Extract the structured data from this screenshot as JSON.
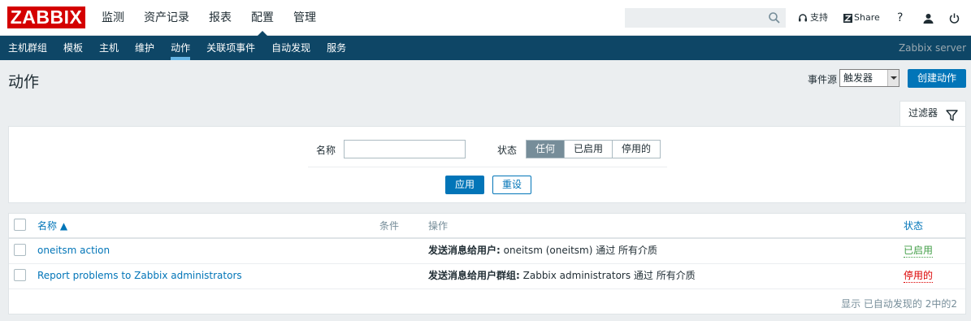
{
  "header": {
    "logo": "ZABBIX",
    "menu": [
      "监测",
      "资产记录",
      "报表",
      "配置",
      "管理"
    ],
    "active_menu": "配置",
    "search_placeholder": "",
    "support_label": "支持",
    "share_label": "Share",
    "help_label": "?"
  },
  "submenu": {
    "items": [
      "主机群组",
      "模板",
      "主机",
      "维护",
      "动作",
      "关联项事件",
      "自动发现",
      "服务"
    ],
    "active": "动作",
    "server_name": "Zabbix server"
  },
  "page": {
    "title": "动作",
    "event_source_label": "事件源",
    "event_source_value": "触发器",
    "create_button": "创建动作"
  },
  "filter": {
    "tab_label": "过滤器",
    "name_label": "名称",
    "name_value": "",
    "status_label": "状态",
    "status_options": [
      "任何",
      "已启用",
      "停用的"
    ],
    "status_selected": "任何",
    "apply_button": "应用",
    "reset_button": "重设"
  },
  "table": {
    "headers": {
      "name": "名称 ▲",
      "conditions": "条件",
      "operations": "操作",
      "status": "状态"
    },
    "rows": [
      {
        "name": "oneitsm action",
        "conditions": "",
        "operation_label": "发送消息给用户:",
        "operation_text": " oneitsm (oneitsm) 通过 所有介质",
        "status": "已启用",
        "status_color": "#429e47"
      },
      {
        "name": "Report problems to Zabbix administrators",
        "conditions": "",
        "operation_label": "发送消息给用户群组:",
        "operation_text": " Zabbix administrators 通过 所有介质",
        "status": "停用的",
        "status_color": "#dc0000"
      }
    ],
    "footer": "显示 已自动发现的 2中的2"
  },
  "colors": {
    "brand": "#d40000",
    "nav": "#0e4666",
    "accent": "#0275b8",
    "enabled": "#429e47",
    "disabled": "#dc0000"
  }
}
